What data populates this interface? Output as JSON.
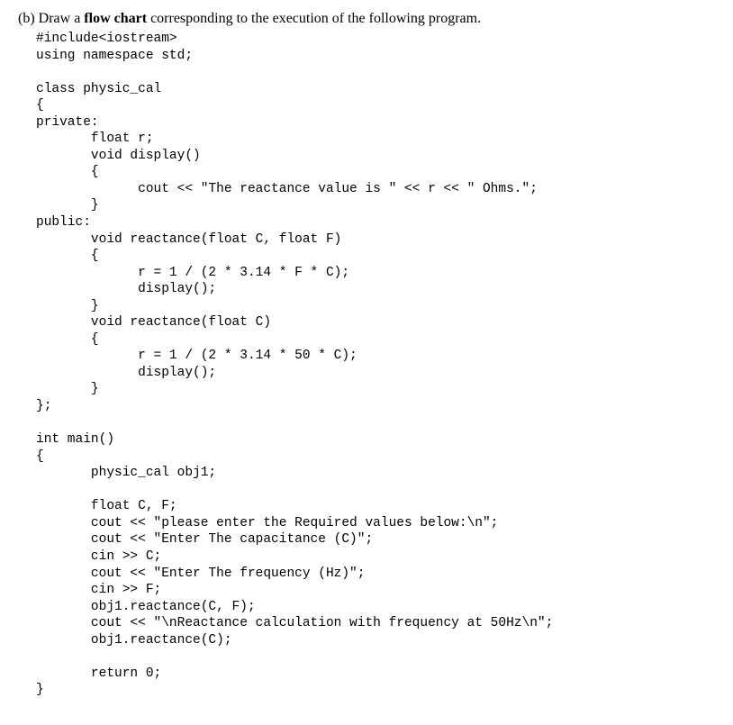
{
  "question": {
    "label": "(b) ",
    "prefix": "Draw a ",
    "bold": "flow chart",
    "suffix": " corresponding to the execution of the following program."
  },
  "code": {
    "line01": "#include<iostream>",
    "line02": "using namespace std;",
    "line03": "",
    "line04": "class physic_cal",
    "line05": "{",
    "line06": "private:",
    "line07": "       float r;",
    "line08": "       void display()",
    "line09": "       {",
    "line10": "             cout << \"The reactance value is \" << r << \" Ohms.\";",
    "line11": "       }",
    "line12": "public:",
    "line13": "       void reactance(float C, float F)",
    "line14": "       {",
    "line15": "             r = 1 / (2 * 3.14 * F * C);",
    "line16": "             display();",
    "line17": "       }",
    "line18": "       void reactance(float C)",
    "line19": "       {",
    "line20": "             r = 1 / (2 * 3.14 * 50 * C);",
    "line21": "             display();",
    "line22": "       }",
    "line23": "};",
    "line24": "",
    "line25": "int main()",
    "line26": "{",
    "line27": "       physic_cal obj1;",
    "line28": "",
    "line29": "       float C, F;",
    "line30": "       cout << \"please enter the Required values below:\\n\";",
    "line31": "       cout << \"Enter The capacitance (C)\";",
    "line32": "       cin >> C;",
    "line33": "       cout << \"Enter The frequency (Hz)\";",
    "line34": "       cin >> F;",
    "line35": "       obj1.reactance(C, F);",
    "line36": "       cout << \"\\nReactance calculation with frequency at 50Hz\\n\";",
    "line37": "       obj1.reactance(C);",
    "line38": "",
    "line39": "       return 0;",
    "line40": "}"
  }
}
